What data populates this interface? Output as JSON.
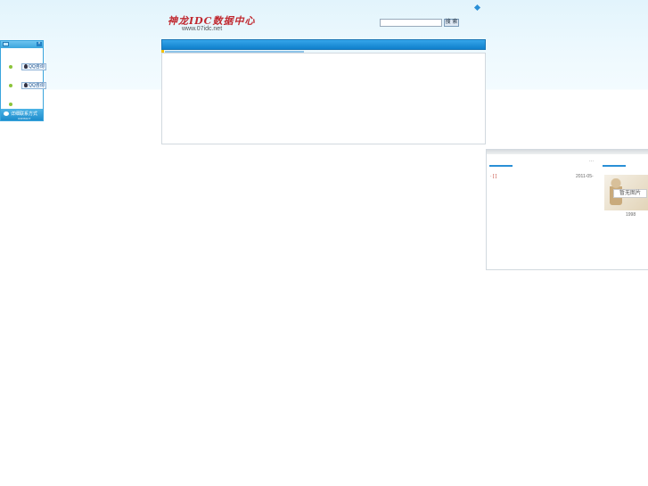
{
  "header": {
    "logo_text": "神龙IDC数据中心",
    "logo_url": "www.07idc.net",
    "search": {
      "value": "",
      "placeholder": "",
      "button_label": "搜 索"
    }
  },
  "float_widget": {
    "qq_buttons": [
      "QQ咨询",
      "QQ咨询"
    ],
    "footer_title": "详细联系方式",
    "footer_sub": "CONTACT",
    "close_label": "×"
  },
  "right_panel": {
    "more_label": "···",
    "news": {
      "title": "· [ ]",
      "date": "2011-05-"
    },
    "image_sign": "暂无图片",
    "image_caption": "1998"
  },
  "colors": {
    "accent": "#2a8fd6",
    "nav": "#1a88d0",
    "logo_red": "#c0282f",
    "dot_green": "#8cc43a"
  }
}
